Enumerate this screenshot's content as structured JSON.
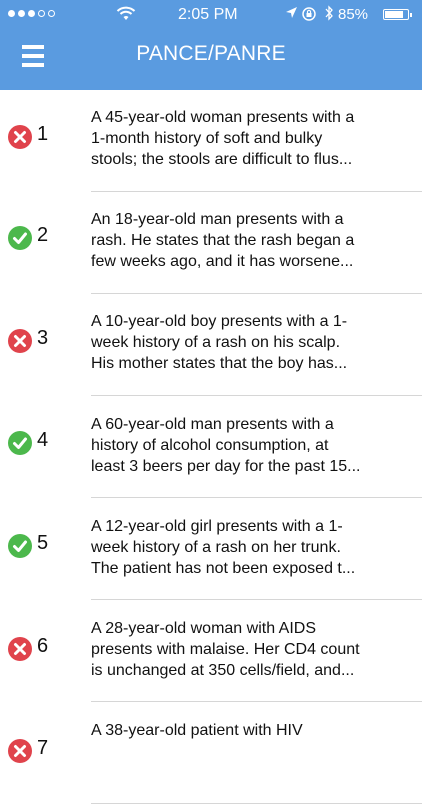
{
  "status_bar": {
    "time": "2:05 PM",
    "battery": "85%",
    "battery_level": 0.85,
    "signal_dots_filled": 3,
    "signal_dots_total": 5,
    "icons": [
      "wifi-icon",
      "location-arrow-icon",
      "rotation-lock-icon",
      "bluetooth-icon",
      "battery-icon"
    ]
  },
  "header": {
    "title": "PANCE/PANRE",
    "menu_icon": "hamburger-menu-icon",
    "background_color": "#5a9be0"
  },
  "colors": {
    "correct": "#4cb84c",
    "incorrect": "#e0434c"
  },
  "questions": [
    {
      "number": "1",
      "status": "incorrect",
      "lines": [
        "A 45-year-old woman presents with a",
        "1-month history of soft and bulky",
        "stools; the stools are difficult to flus..."
      ]
    },
    {
      "number": "2",
      "status": "correct",
      "lines": [
        "An 18-year-old man presents with a",
        "rash. He states that the rash began a",
        "few weeks ago, and it has worsene..."
      ]
    },
    {
      "number": "3",
      "status": "incorrect",
      "lines": [
        "A 10-year-old boy presents with a 1-",
        "week history of a rash on his scalp.",
        "His mother states that the boy has..."
      ]
    },
    {
      "number": "4",
      "status": "correct",
      "lines": [
        "A 60-year-old man presents with a",
        "history of alcohol consumption, at",
        "least 3 beers per day for the past 15..."
      ]
    },
    {
      "number": "5",
      "status": "correct",
      "lines": [
        "A 12-year-old girl presents with a 1-",
        "week history of a rash on her trunk.",
        "The patient has not been exposed t..."
      ]
    },
    {
      "number": "6",
      "status": "incorrect",
      "lines": [
        "A 28-year-old woman with AIDS",
        "presents with malaise. Her CD4 count",
        "is unchanged at 350 cells/field, and..."
      ]
    },
    {
      "number": "7",
      "status": "incorrect",
      "lines": [
        "A 38-year-old patient with HIV",
        "",
        ""
      ]
    }
  ]
}
